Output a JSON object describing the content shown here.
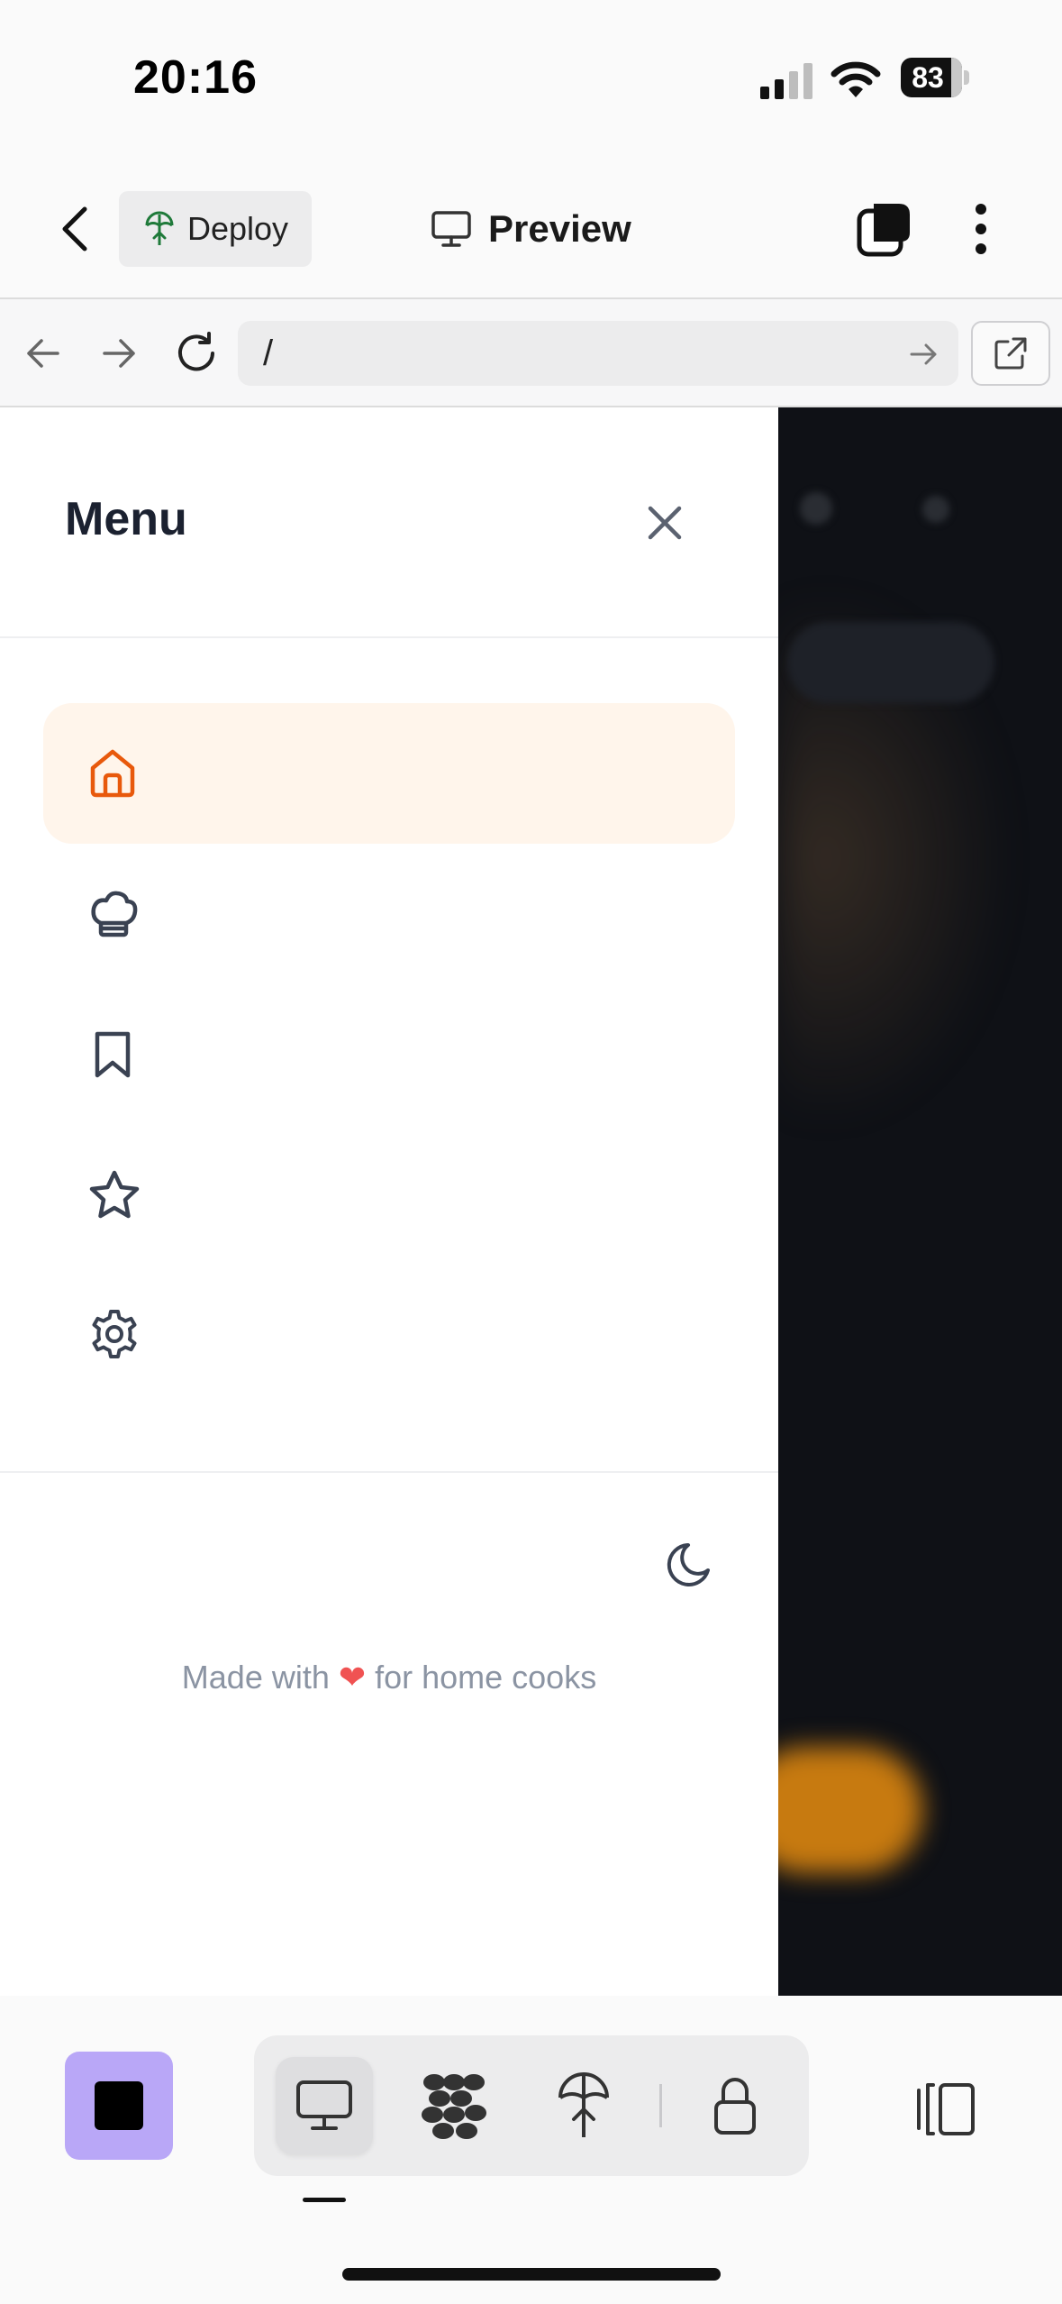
{
  "status_bar": {
    "time": "20:16",
    "battery": "83",
    "icons": [
      "cellular-signal-icon",
      "wifi-icon",
      "battery-icon"
    ]
  },
  "header": {
    "deploy_label": "Deploy",
    "preview_label": "Preview",
    "icons": [
      "back-chevron-icon",
      "deploy-icon",
      "monitor-icon",
      "tabs-icon",
      "more-vertical-icon"
    ]
  },
  "url_bar": {
    "url": "/",
    "icons": [
      "nav-back-icon",
      "nav-forward-icon",
      "reload-icon",
      "go-arrow-icon",
      "external-link-icon"
    ]
  },
  "drawer": {
    "title": "Menu",
    "items": [
      {
        "icon": "home-icon",
        "active": true
      },
      {
        "icon": "chef-hat-icon",
        "active": false
      },
      {
        "icon": "bookmark-icon",
        "active": false
      },
      {
        "icon": "star-icon",
        "active": false
      },
      {
        "icon": "settings-icon",
        "active": false
      }
    ],
    "footer_prefix": "Made with",
    "footer_heart": "❤",
    "footer_suffix": "for home cooks",
    "theme_icon": "moon-icon"
  },
  "colors": {
    "accent": "#e8590c",
    "active_bg": "#fff5eb",
    "stop_button": "#b9a7f7",
    "heart": "#f05252"
  },
  "toolbar": {
    "icons": [
      "stop-icon",
      "monitor-icon",
      "agents-icon",
      "deploy-icon",
      "lock-icon",
      "split-view-icon"
    ],
    "active": "monitor-icon"
  }
}
